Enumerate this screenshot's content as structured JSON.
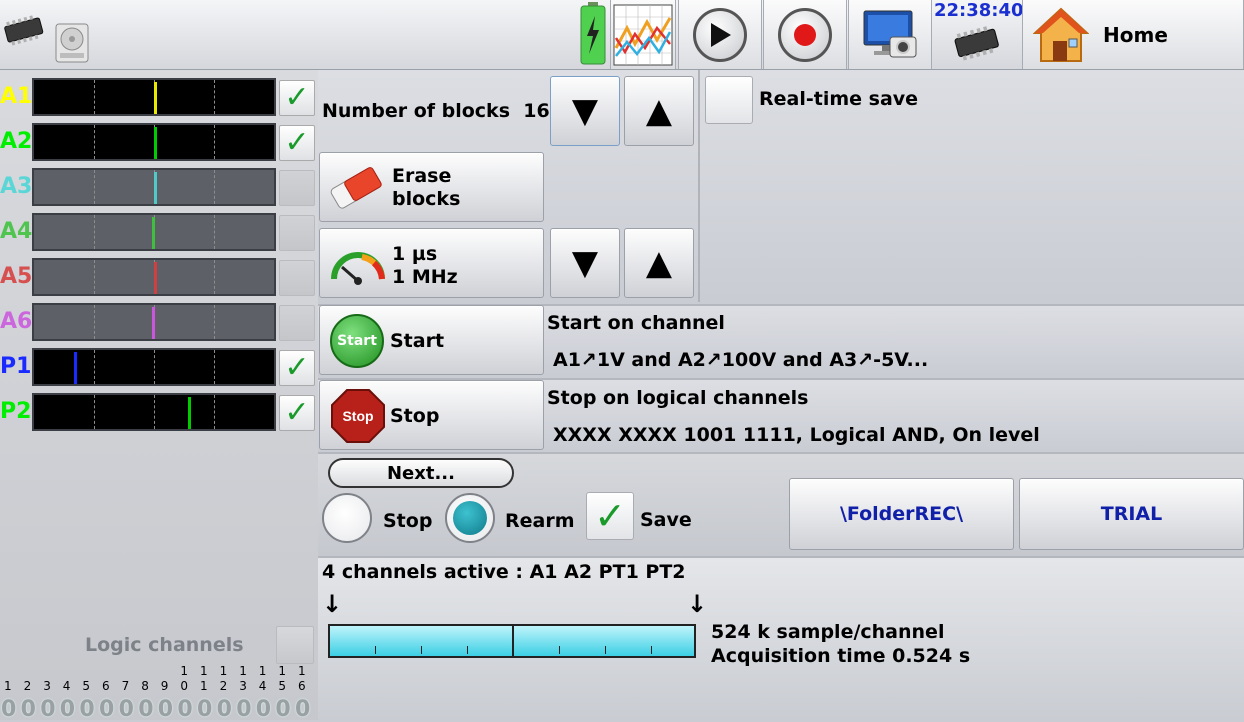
{
  "header": {
    "time": "22:38:40",
    "home_label": "Home",
    "icons": [
      "chip-icon",
      "disk-icon",
      "battery-icon",
      "chart-icon",
      "play-icon",
      "record-icon",
      "screenshot-icon",
      "chip-small-icon",
      "house-icon"
    ]
  },
  "channels": [
    {
      "name": "A1",
      "color": "#ffff00",
      "active": true,
      "marker": "#e8e800"
    },
    {
      "name": "A2",
      "color": "#00ee00",
      "active": true,
      "marker": "#00cc00"
    },
    {
      "name": "A3",
      "color": "#5ad6d6",
      "active": false,
      "marker": "#53c8c8"
    },
    {
      "name": "A4",
      "color": "#4fc54f",
      "active": false,
      "marker": "#3ec03e"
    },
    {
      "name": "A5",
      "color": "#d75050",
      "active": false,
      "marker": "#d04040"
    },
    {
      "name": "A6",
      "color": "#cc66dd",
      "active": false,
      "marker": "#cc55dd"
    },
    {
      "name": "P1",
      "color": "#1a2bff",
      "active": true,
      "marker": "#1a2bff"
    },
    {
      "name": "P2",
      "color": "#00ee00",
      "active": true,
      "marker": "#00cc00"
    }
  ],
  "blocks": {
    "label": "Number of blocks",
    "value": "16",
    "down": "▼",
    "up": "▲"
  },
  "realtime_save_label": "Real-time save",
  "erase": {
    "line1": "Erase",
    "line2": "blocks"
  },
  "sampling": {
    "line1": "1 µs",
    "line2": "1 MHz"
  },
  "start": {
    "label": "Start",
    "icon_text": "Start",
    "title": "Start on channel",
    "condition": "A1↗1V and  A2↗100V and  A3↗-5V..."
  },
  "stop": {
    "label": "Stop",
    "icon_text": "Stop",
    "title": "Stop on logical channels",
    "condition": "XXXX XXXX 1001 1111, Logical AND, On level"
  },
  "next": {
    "label": "Next...",
    "stop_label": "Stop",
    "rearm_label": "Rearm",
    "save_label": "Save",
    "folder": "\\FolderREC\\",
    "file": "TRIAL"
  },
  "status": {
    "active": "4 channels active : A1 A2 PT1 PT2",
    "samples": "524 k sample/channel",
    "acq_time": "Acquisition time 0.524 s"
  },
  "logic": {
    "label": "Logic channels",
    "top_digits": [
      "1",
      "1",
      "1",
      "1",
      "1",
      "1",
      "1"
    ],
    "bottom_digits": [
      "1",
      "2",
      "3",
      "4",
      "5",
      "6",
      "7",
      "8",
      "9",
      "0",
      "1",
      "2",
      "3",
      "4",
      "5",
      "6"
    ],
    "values": [
      "0",
      "0",
      "0",
      "0",
      "0",
      "0",
      "0",
      "0",
      "0",
      "0",
      "0",
      "0",
      "0",
      "0",
      "0",
      "0"
    ]
  }
}
